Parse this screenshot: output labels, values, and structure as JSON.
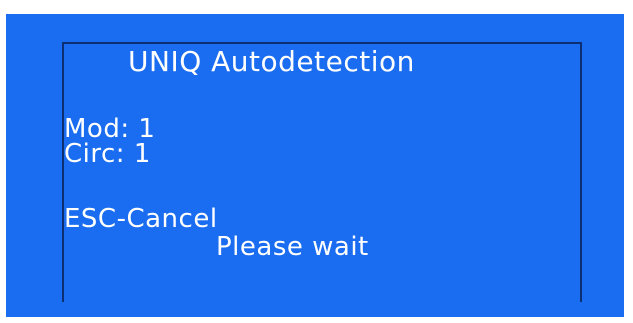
{
  "display": {
    "title": "UNIQ Autodetection",
    "mod_label": "Mod: 1",
    "circ_label": "Circ: 1",
    "cancel_hint": "ESC-Cancel",
    "status": "Please wait"
  },
  "colors": {
    "background": "#1a6cf0",
    "text": "#ffffff",
    "border": "#0b2f72"
  }
}
